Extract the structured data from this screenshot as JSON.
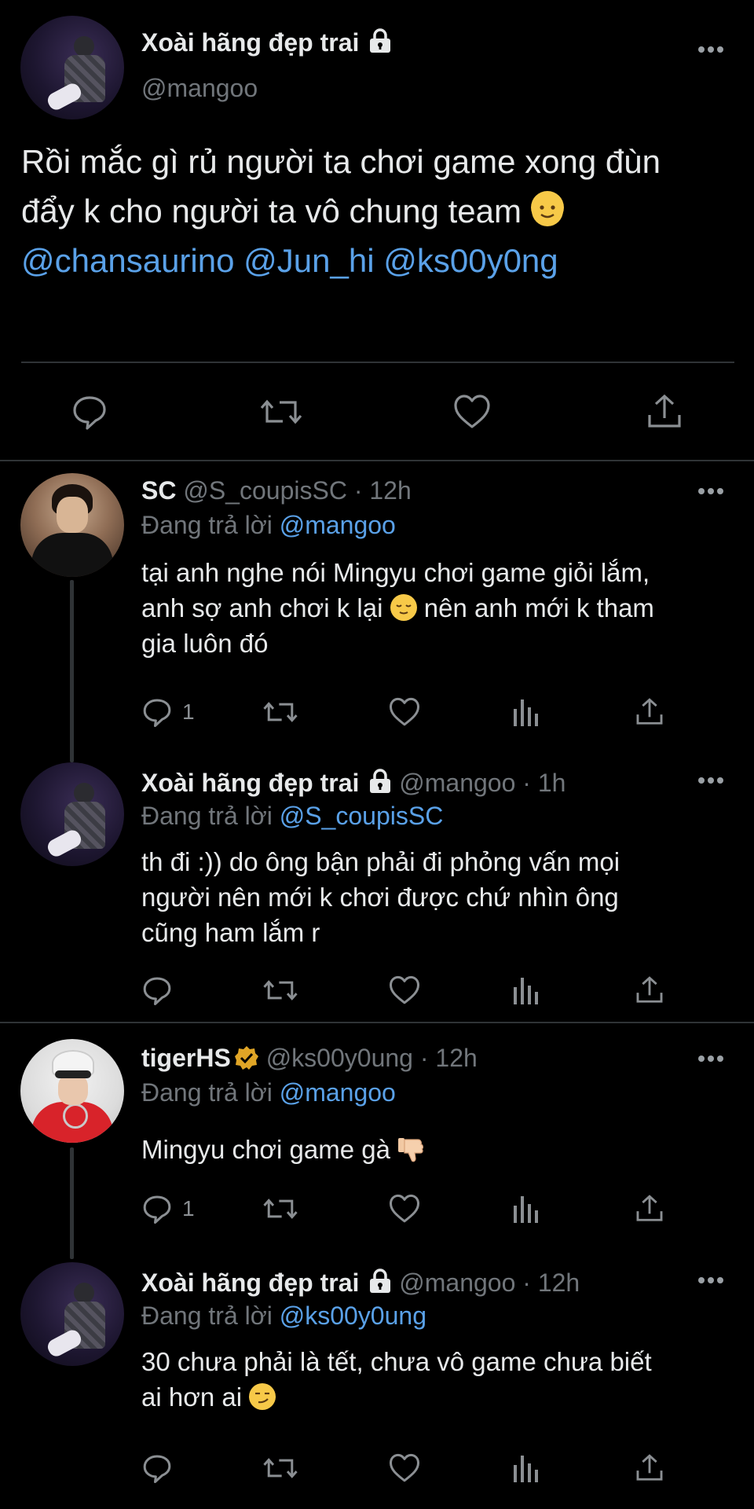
{
  "main_tweet": {
    "display_name": "Xoài hãng đẹp trai",
    "handle": "@mangoo",
    "text_line1": "Rồi mắc gì rủ người ta chơi game xong đùn",
    "text_line2": "đẩy k cho người ta vô chung team",
    "mentions": [
      "@chansaurino",
      "@Jun_hi",
      "@ks00y0ng"
    ]
  },
  "replies": [
    {
      "display_name": "SC",
      "handle": "@S_coupisSC",
      "time": "12h",
      "reply_prefix": "Đang trả lời",
      "reply_to": "@mangoo",
      "line1": "tại anh nghe nói Mingyu chơi game giỏi lắm,",
      "line2a": "anh sợ anh chơi k lại",
      "line2b": "nên anh mới k tham",
      "line3": "gia luôn đó",
      "reply_count": "1"
    },
    {
      "display_name": "Xoài hãng đẹp trai",
      "handle": "@mangoo",
      "time": "1h",
      "reply_prefix": "Đang trả lời",
      "reply_to": "@S_coupisSC",
      "line1": "th đi :)) do ông bận phải đi phỏng vấn mọi",
      "line2": "người nên mới k chơi được chứ nhìn ông",
      "line3": "cũng ham lắm r",
      "reply_count": ""
    },
    {
      "display_name": "tigerHS",
      "handle": "@ks00y0ung",
      "time": "12h",
      "reply_prefix": "Đang trả lời",
      "reply_to": "@mangoo",
      "line1": "Mingyu chơi game gà",
      "reply_count": "1"
    },
    {
      "display_name": "Xoài hãng đẹp trai",
      "handle": "@mangoo",
      "time": "12h",
      "reply_prefix": "Đang trả lời",
      "reply_to": "@ks00y0ung",
      "line1": "30 chưa phải là tết, chưa vô game chưa biết",
      "line2": "ai hơn ai",
      "reply_count": ""
    }
  ],
  "separator": " · ",
  "icons": [
    "lock-icon",
    "more-icon",
    "reply-icon",
    "retweet-icon",
    "like-icon",
    "views-icon",
    "share-icon",
    "verified-icon"
  ],
  "colors": {
    "background": "#000000",
    "text": "#e7e9ea",
    "secondary": "#71767b",
    "link": "#5aa1e8",
    "verified": "#e0a526"
  }
}
